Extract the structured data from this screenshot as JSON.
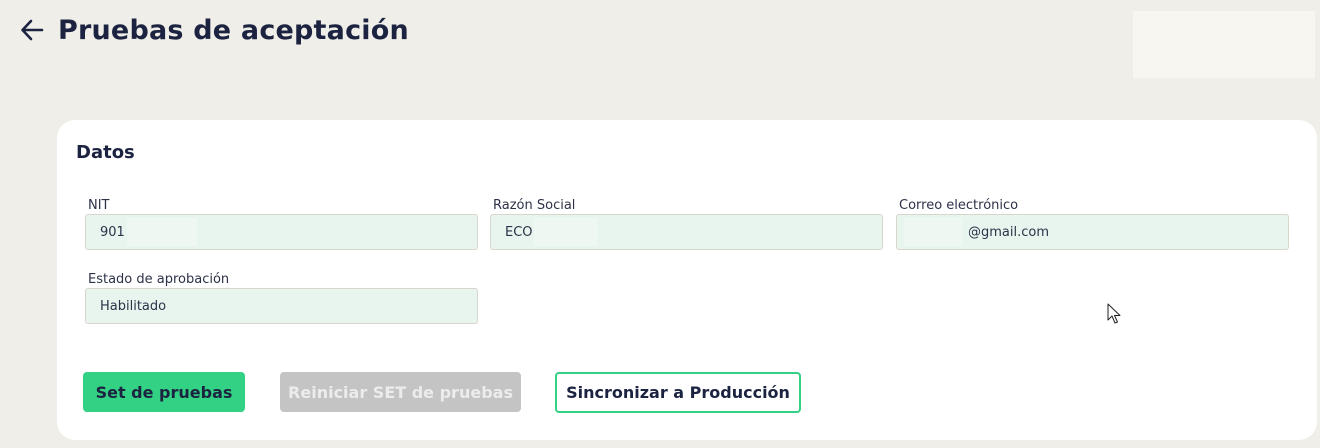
{
  "header": {
    "title": "Pruebas de aceptación",
    "back_icon": "arrow-left-icon"
  },
  "card": {
    "title": "Datos",
    "fields": [
      {
        "label": "NIT",
        "value": "901"
      },
      {
        "label": "Razón Social",
        "value": "ECO"
      },
      {
        "label": "Correo electrónico",
        "value": "@gmail.com"
      },
      {
        "label": "Estado de aprobación",
        "value": "Habilitado"
      }
    ],
    "buttons": {
      "set_pruebas": "Set de pruebas",
      "reiniciar": "Reiniciar SET de pruebas",
      "sincronizar": "Sincronizar a Producción"
    }
  },
  "colors": {
    "background": "#efeee8",
    "accent": "#33d184",
    "text": "#1c2341",
    "field_bg": "#e8f5ee",
    "disabled": "#c4c4c4"
  }
}
